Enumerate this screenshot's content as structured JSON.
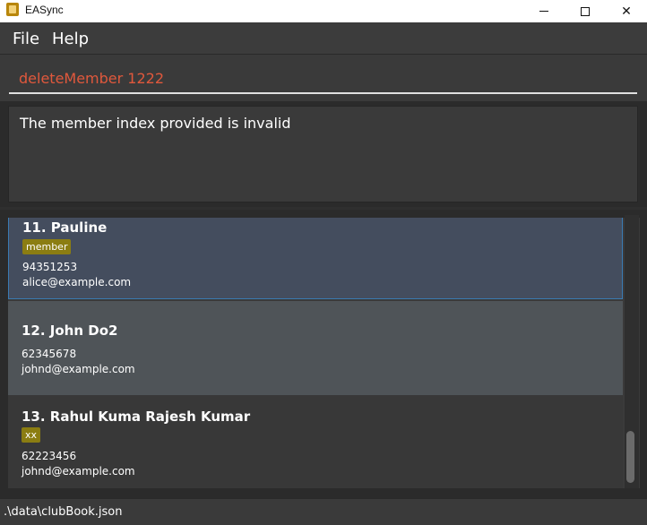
{
  "window": {
    "title": "EASync",
    "minimize_glyph": "",
    "maximize_glyph": "",
    "close_glyph": "✕"
  },
  "menu": {
    "file": "File",
    "help": "Help"
  },
  "command": {
    "value": "deleteMember 1222"
  },
  "result": {
    "text": "The member index provided is invalid"
  },
  "members": [
    {
      "name": "11. Pauline",
      "tag": "member",
      "phone": "94351253",
      "email": "alice@example.com"
    },
    {
      "name": "12. John Do2",
      "tag": "",
      "phone": "62345678",
      "email": "johnd@example.com"
    },
    {
      "name": "13. Rahul Kuma Rajesh Kumar",
      "tag": "xx",
      "phone": "62223456",
      "email": "johnd@example.com"
    }
  ],
  "status": {
    "path": ".\\data\\clubBook.json"
  },
  "colors": {
    "command_text": "#e0583c",
    "selected_card": "#444d5e",
    "tag_bg": "#8b7d12"
  }
}
